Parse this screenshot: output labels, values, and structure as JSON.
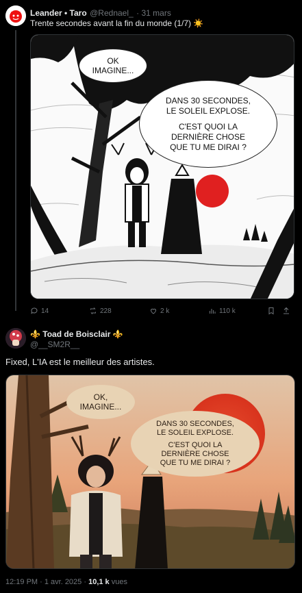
{
  "tweet1": {
    "author_name": "Leander • Taro",
    "handle": "@Rednael_",
    "date": "· 31 mars",
    "text": "Trente secondes avant la fin du monde (1/7) ☀️",
    "image": {
      "bubble_small": [
        "OK",
        "IMAGINE..."
      ],
      "bubble_large": [
        "DANS 30 SECONDES,",
        "LE SOLEIL EXPLOSE.",
        "",
        "C'EST QUOI LA",
        "DERNIÈRE CHOSE",
        "QUE TU ME DIRAI ?"
      ]
    },
    "actions": {
      "replies": "14",
      "reposts": "228",
      "likes": "2 k",
      "views": "110 k"
    }
  },
  "tweet2": {
    "author_name": "⚜️ Toad de Boisclair ⚜️",
    "handle": "@__SM2R__",
    "text": "Fixed, L'IA est le meilleur des artistes.",
    "image": {
      "bubble_small": [
        "OK,",
        "IMAGINE..."
      ],
      "bubble_large": [
        "DANS 30 SECONDES,",
        "LE SOLEIL EXPLOSE.",
        "",
        "C'EST QUOI LA",
        "DERNIÈRE CHOSE",
        "QUE TU ME DIRAI ?"
      ]
    },
    "time": "12:19 PM · 1 avr. 2025 · ",
    "views_count": "10,1 k",
    "views_label": " vues"
  },
  "colors": {
    "background": "#000000",
    "text_primary": "#e7e9ea",
    "text_secondary": "#71767b",
    "sun_red": "#e02020"
  }
}
